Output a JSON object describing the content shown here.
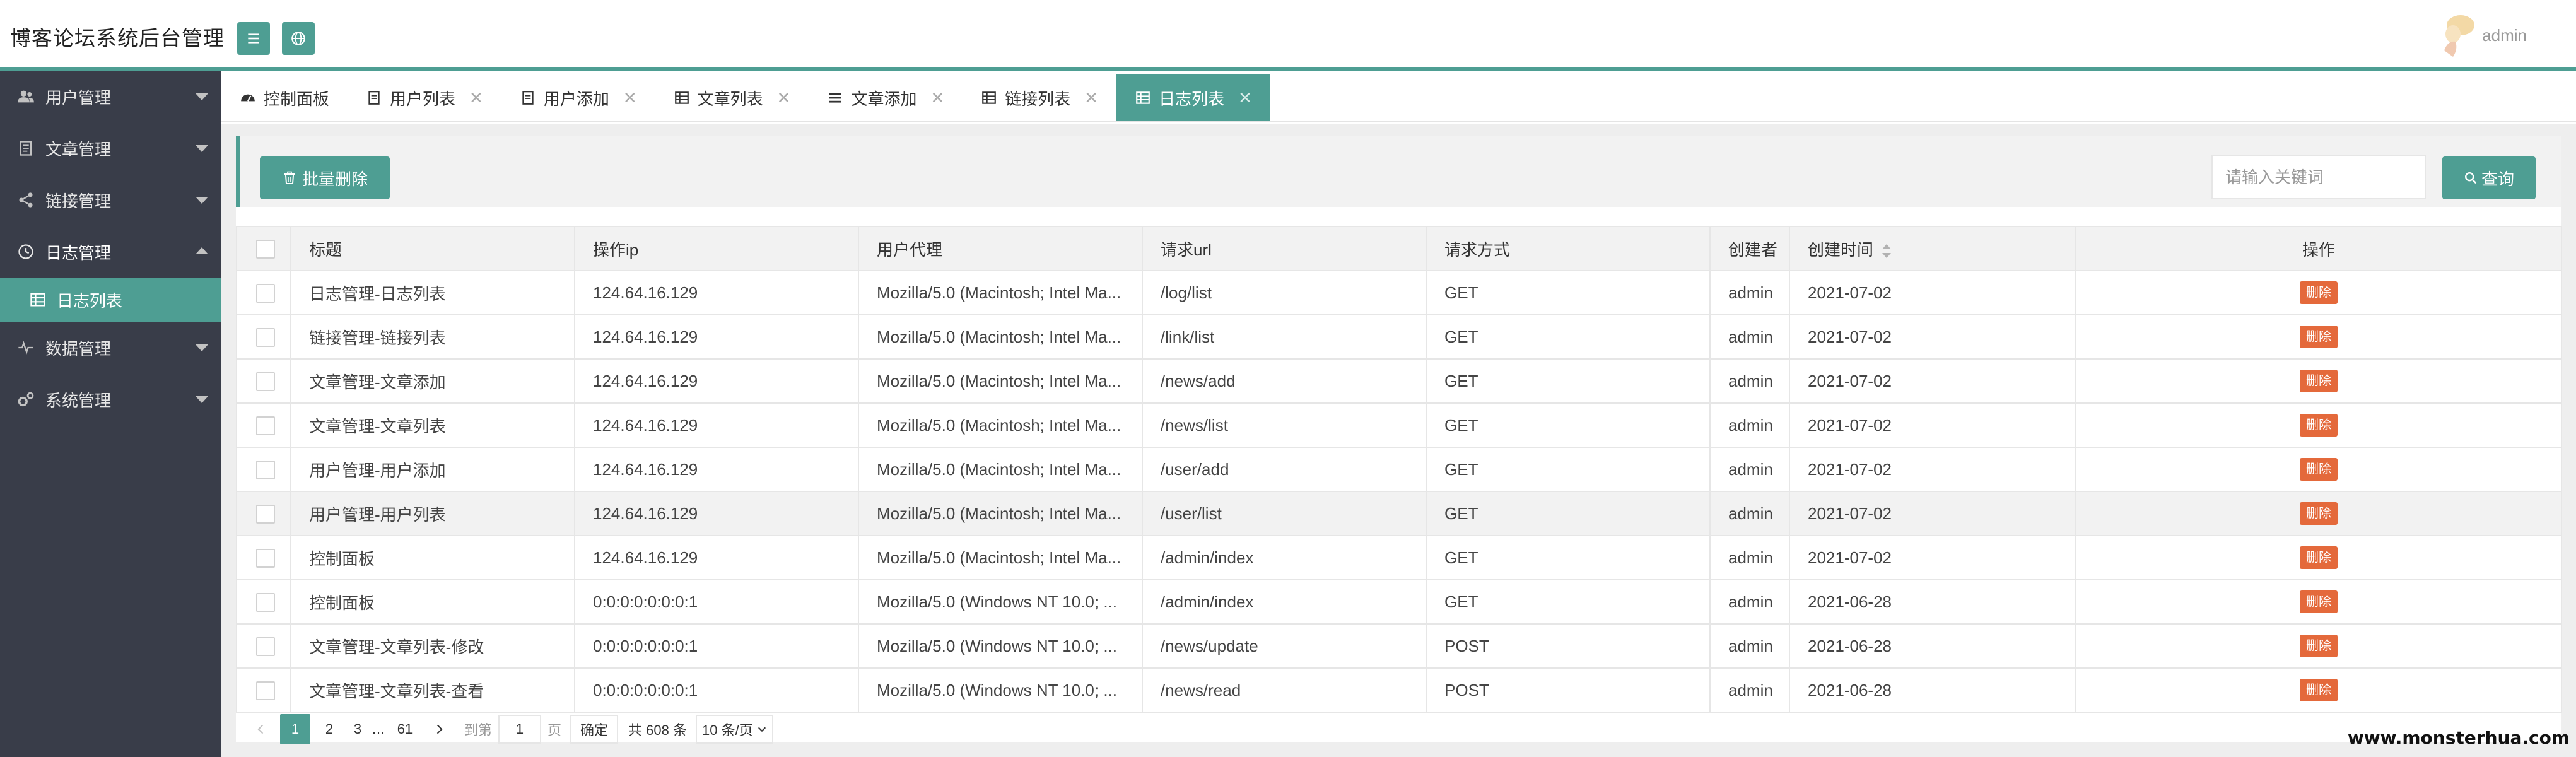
{
  "header": {
    "title": "博客论坛系统后台管理",
    "user_name": "admin"
  },
  "sidebar": {
    "items": [
      {
        "label": "用户管理",
        "icon": "users-icon"
      },
      {
        "label": "文章管理",
        "icon": "document-icon"
      },
      {
        "label": "链接管理",
        "icon": "share-icon"
      },
      {
        "label": "日志管理",
        "icon": "history-icon",
        "expanded": true
      },
      {
        "label": "数据管理",
        "icon": "pulse-icon"
      },
      {
        "label": "系统管理",
        "icon": "gears-icon"
      }
    ],
    "sub_item": {
      "label": "日志列表",
      "icon": "table-icon"
    }
  },
  "tabs": [
    {
      "label": "控制面板",
      "closable": false
    },
    {
      "label": "用户列表",
      "closable": true
    },
    {
      "label": "用户添加",
      "closable": true
    },
    {
      "label": "文章列表",
      "closable": true
    },
    {
      "label": "文章添加",
      "closable": true
    },
    {
      "label": "链接列表",
      "closable": true
    },
    {
      "label": "日志列表",
      "closable": true,
      "active": true
    }
  ],
  "tab_close_glyph": "✕",
  "toolbar": {
    "batch_delete_label": "批量删除",
    "search_placeholder": "请输入关键词",
    "query_label": "查询"
  },
  "table": {
    "columns": [
      "标题",
      "操作ip",
      "用户代理",
      "请求url",
      "请求方式",
      "创建者",
      "创建时间",
      "操作"
    ],
    "delete_label": "删除",
    "rows": [
      {
        "title": "日志管理-日志列表",
        "ip": "124.64.16.129",
        "agent": "Mozilla/5.0 (Macintosh; Intel Ma...",
        "url": "/log/list",
        "method": "GET",
        "creator": "admin",
        "time": "2021-07-02"
      },
      {
        "title": "链接管理-链接列表",
        "ip": "124.64.16.129",
        "agent": "Mozilla/5.0 (Macintosh; Intel Ma...",
        "url": "/link/list",
        "method": "GET",
        "creator": "admin",
        "time": "2021-07-02"
      },
      {
        "title": "文章管理-文章添加",
        "ip": "124.64.16.129",
        "agent": "Mozilla/5.0 (Macintosh; Intel Ma...",
        "url": "/news/add",
        "method": "GET",
        "creator": "admin",
        "time": "2021-07-02"
      },
      {
        "title": "文章管理-文章列表",
        "ip": "124.64.16.129",
        "agent": "Mozilla/5.0 (Macintosh; Intel Ma...",
        "url": "/news/list",
        "method": "GET",
        "creator": "admin",
        "time": "2021-07-02"
      },
      {
        "title": "用户管理-用户添加",
        "ip": "124.64.16.129",
        "agent": "Mozilla/5.0 (Macintosh; Intel Ma...",
        "url": "/user/add",
        "method": "GET",
        "creator": "admin",
        "time": "2021-07-02"
      },
      {
        "title": "用户管理-用户列表",
        "ip": "124.64.16.129",
        "agent": "Mozilla/5.0 (Macintosh; Intel Ma...",
        "url": "/user/list",
        "method": "GET",
        "creator": "admin",
        "time": "2021-07-02",
        "hover": true
      },
      {
        "title": "控制面板",
        "ip": "124.64.16.129",
        "agent": "Mozilla/5.0 (Macintosh; Intel Ma...",
        "url": "/admin/index",
        "method": "GET",
        "creator": "admin",
        "time": "2021-07-02"
      },
      {
        "title": "控制面板",
        "ip": "0:0:0:0:0:0:0:1",
        "agent": "Mozilla/5.0 (Windows NT 10.0; ...",
        "url": "/admin/index",
        "method": "GET",
        "creator": "admin",
        "time": "2021-06-28"
      },
      {
        "title": "文章管理-文章列表-修改",
        "ip": "0:0:0:0:0:0:0:1",
        "agent": "Mozilla/5.0 (Windows NT 10.0; ...",
        "url": "/news/update",
        "method": "POST",
        "creator": "admin",
        "time": "2021-06-28"
      },
      {
        "title": "文章管理-文章列表-查看",
        "ip": "0:0:0:0:0:0:0:1",
        "agent": "Mozilla/5.0 (Windows NT 10.0; ...",
        "url": "/news/read",
        "method": "POST",
        "creator": "admin",
        "time": "2021-06-28"
      }
    ]
  },
  "pager": {
    "pages": [
      "1",
      "2",
      "3"
    ],
    "ellipsis": "…",
    "last_page": "61",
    "goto_label": "到第",
    "goto_value": "1",
    "page_unit": "页",
    "ok_label": "确定",
    "total_label": "共 608 条",
    "page_size_label": "10 条/页"
  },
  "watermark": "www.monsterhua.com",
  "colors": {
    "accent": "#4e9e93",
    "sidebar_bg": "#393d49",
    "delete": "#e4693b"
  }
}
